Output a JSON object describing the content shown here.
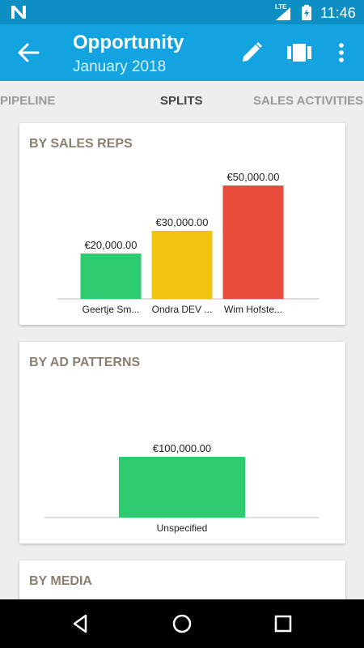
{
  "status_bar": {
    "network": "LTE",
    "time": "11:46"
  },
  "app_bar": {
    "title": "Opportunity",
    "subtitle": "January 2018",
    "icons": [
      "back-arrow-icon",
      "edit-pencil-icon",
      "card-view-icon",
      "more-vert-icon"
    ]
  },
  "tabs": [
    {
      "label": "PIPELINE"
    },
    {
      "label": "SPLITS",
      "active": true
    },
    {
      "label": "SALES ACTIVITIES"
    }
  ],
  "cards": [
    {
      "title": "BY SALES REPS",
      "chart_data": {
        "type": "bar",
        "categories": [
          "Geertje Sm...",
          "Ondra DEV ...",
          "Wim Hofste..."
        ],
        "values": [
          20000,
          30000,
          50000
        ],
        "labels": [
          "€20,000.00",
          "€30,000.00",
          "€50,000.00"
        ],
        "colors": [
          "#2ecc71",
          "#f1c40f",
          "#e74c3c"
        ]
      }
    },
    {
      "title": "BY AD PATTERNS",
      "chart_data": {
        "type": "bar",
        "categories": [
          "Unspecified"
        ],
        "values": [
          100000
        ],
        "labels": [
          "€100,000.00"
        ],
        "colors": [
          "#2ecc71"
        ]
      }
    },
    {
      "title": "BY MEDIA"
    }
  ],
  "colors": {
    "status_bar": "#0e8fc4",
    "app_bar": "#12a3e0",
    "card_title": "#8a7f70"
  },
  "nav_bar": {
    "icons": [
      "back-triangle-icon",
      "home-circle-icon",
      "recents-square-icon"
    ]
  }
}
